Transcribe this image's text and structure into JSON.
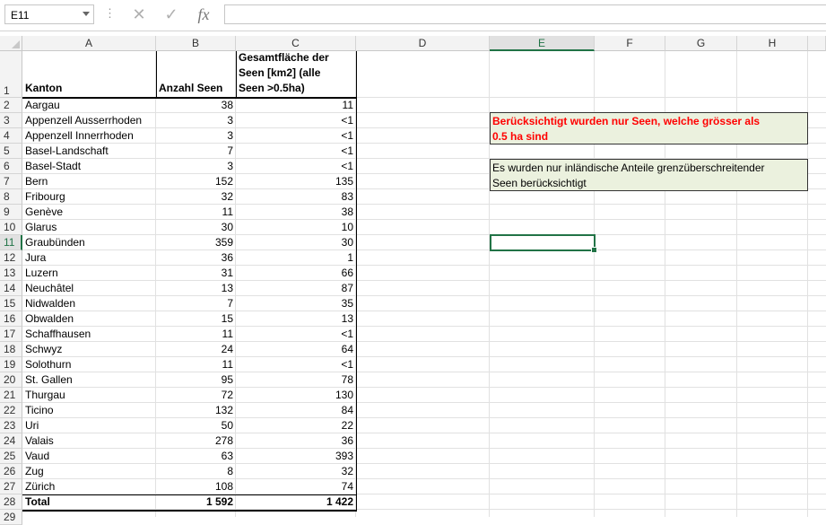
{
  "formula_bar": {
    "name_box": "E11",
    "cancel_icon": "cancel-icon",
    "enter_icon": "check-icon",
    "fx_label": "fx",
    "formula": ""
  },
  "columns": [
    "A",
    "B",
    "C",
    "D",
    "E",
    "F",
    "G",
    "H"
  ],
  "selected_column": "E",
  "row_numbers": [
    "1",
    "2",
    "3",
    "4",
    "5",
    "6",
    "7",
    "8",
    "9",
    "10",
    "11",
    "12",
    "13",
    "14",
    "15",
    "16",
    "17",
    "18",
    "19",
    "20",
    "21",
    "22",
    "23",
    "24",
    "25",
    "26",
    "27",
    "28",
    "29"
  ],
  "selected_row": "11",
  "table": {
    "headers": {
      "kanton": "Kanton",
      "anzahl": "Anzahl Seen",
      "flaeche_line1": "Gesamtfläche der",
      "flaeche_line2": "Seen [km2] (alle",
      "flaeche_line3": "Seen >0.5ha)"
    },
    "rows": [
      {
        "kanton": "Aargau",
        "anzahl": "38",
        "flaeche": "11"
      },
      {
        "kanton": "Appenzell Ausserrhoden",
        "anzahl": "3",
        "flaeche": "<1"
      },
      {
        "kanton": "Appenzell Innerrhoden",
        "anzahl": "3",
        "flaeche": "<1"
      },
      {
        "kanton": "Basel-Landschaft",
        "anzahl": "7",
        "flaeche": "<1"
      },
      {
        "kanton": "Basel-Stadt",
        "anzahl": "3",
        "flaeche": "<1"
      },
      {
        "kanton": "Bern",
        "anzahl": "152",
        "flaeche": "135"
      },
      {
        "kanton": "Fribourg",
        "anzahl": "32",
        "flaeche": "83"
      },
      {
        "kanton": "Genève",
        "anzahl": "11",
        "flaeche": "38"
      },
      {
        "kanton": "Glarus",
        "anzahl": "30",
        "flaeche": "10"
      },
      {
        "kanton": "Graubünden",
        "anzahl": "359",
        "flaeche": "30"
      },
      {
        "kanton": "Jura",
        "anzahl": "36",
        "flaeche": "1"
      },
      {
        "kanton": "Luzern",
        "anzahl": "31",
        "flaeche": "66"
      },
      {
        "kanton": "Neuchâtel",
        "anzahl": "13",
        "flaeche": "87"
      },
      {
        "kanton": "Nidwalden",
        "anzahl": "7",
        "flaeche": "35"
      },
      {
        "kanton": "Obwalden",
        "anzahl": "15",
        "flaeche": "13"
      },
      {
        "kanton": "Schaffhausen",
        "anzahl": "11",
        "flaeche": "<1"
      },
      {
        "kanton": "Schwyz",
        "anzahl": "24",
        "flaeche": "64"
      },
      {
        "kanton": "Solothurn",
        "anzahl": "11",
        "flaeche": "<1"
      },
      {
        "kanton": "St. Gallen",
        "anzahl": "95",
        "flaeche": "78"
      },
      {
        "kanton": "Thurgau",
        "anzahl": "72",
        "flaeche": "130"
      },
      {
        "kanton": "Ticino",
        "anzahl": "132",
        "flaeche": "84"
      },
      {
        "kanton": "Uri",
        "anzahl": "50",
        "flaeche": "22"
      },
      {
        "kanton": "Valais",
        "anzahl": "278",
        "flaeche": "36"
      },
      {
        "kanton": "Vaud",
        "anzahl": "63",
        "flaeche": "393"
      },
      {
        "kanton": "Zug",
        "anzahl": "8",
        "flaeche": "32"
      },
      {
        "kanton": "Zürich",
        "anzahl": "108",
        "flaeche": "74"
      }
    ],
    "total": {
      "kanton": "Total",
      "anzahl": "1 592",
      "flaeche": "1 422"
    }
  },
  "notes": {
    "note1_line1": "Berücksichtigt wurden nur Seen, welche grösser als",
    "note1_line2": "0.5 ha sind",
    "note2_line1": "Es wurden nur inländische Anteile grenzüberschreitender",
    "note2_line2": "Seen berücksichtigt"
  },
  "colors": {
    "accent": "#217346",
    "note_fill": "#ebf1de",
    "note1_text": "#ff0000"
  }
}
